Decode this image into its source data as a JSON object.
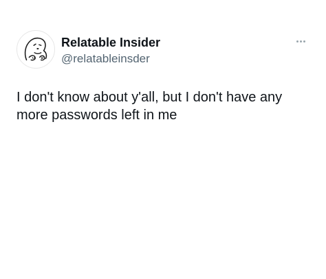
{
  "tweet": {
    "author": {
      "display_name": "Relatable Insider",
      "handle": "@relatableinsder",
      "avatar_icon": "cartoon-face-icon"
    },
    "more_icon": "ellipsis-icon",
    "text": "I don't know about y'all, but I don't have any more passwords left in me"
  },
  "colors": {
    "background": "#ffffff",
    "primary_text": "#0f1419",
    "secondary_text": "#536471"
  }
}
